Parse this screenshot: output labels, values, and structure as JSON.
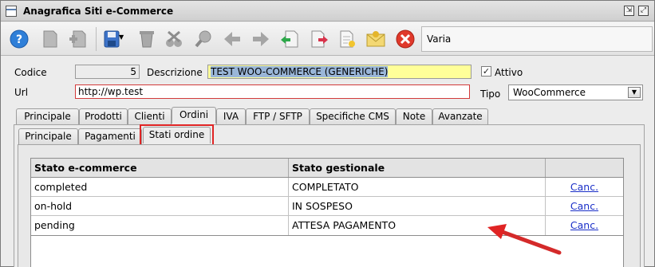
{
  "window": {
    "title": "Anagrafica Siti e-Commerce"
  },
  "toolbar": {
    "buttons": [
      "help-icon",
      "new-document-icon",
      "add-document-icon",
      "save-icon",
      "delete-icon",
      "cut-icon",
      "search-icon",
      "arrow-left-icon",
      "arrow-right-icon",
      "import-icon",
      "export-icon",
      "edit-document-icon",
      "mail-icon",
      "close-icon"
    ],
    "varia_label": "Varia"
  },
  "form": {
    "codice_label": "Codice",
    "codice_value": "5",
    "descrizione_label": "Descrizione",
    "descrizione_value": "TEST WOO-COMMERCE (GENERICHE)",
    "attivo_label": "Attivo",
    "attivo_checked": "✓",
    "url_label": "Url",
    "url_value": "http://wp.test",
    "tipo_label": "Tipo",
    "tipo_value": "WooCommerce"
  },
  "main_tabs": [
    "Principale",
    "Prodotti",
    "Clienti",
    "Ordini",
    "IVA",
    "FTP / SFTP",
    "Specifiche CMS",
    "Note",
    "Avanzate"
  ],
  "main_tab_active": "Ordini",
  "sub_tabs": [
    "Principale",
    "Pagamenti",
    "Stati ordine"
  ],
  "sub_tab_active": "Stati ordine",
  "table": {
    "headers": [
      "Stato e-commerce",
      "Stato gestionale",
      ""
    ],
    "rows": [
      {
        "ecommerce": "completed",
        "gestionale": "COMPLETATO",
        "action": "Canc."
      },
      {
        "ecommerce": "on-hold",
        "gestionale": "IN SOSPESO",
        "action": "Canc."
      },
      {
        "ecommerce": "pending",
        "gestionale": "ATTESA PAGAMENTO",
        "action": "Canc."
      }
    ]
  },
  "colors": {
    "highlight_red": "#e02424",
    "link_blue": "#1a2fc8",
    "yellow_field": "#ffff99"
  }
}
